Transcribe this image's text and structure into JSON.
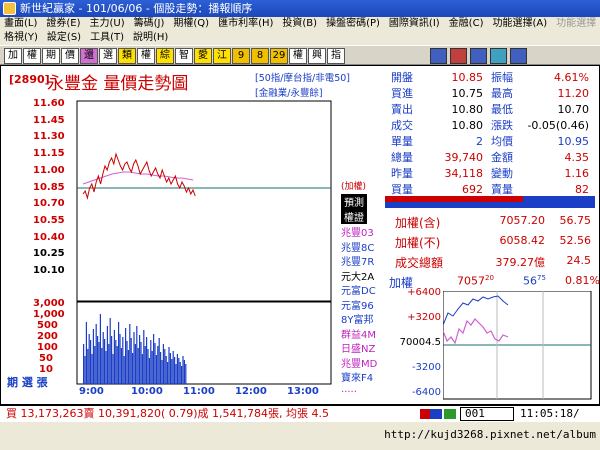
{
  "window": {
    "title": "新世紀贏家 - 101/06/06 - 個股走勢：播報順序"
  },
  "menu": {
    "row1": [
      "畫面(L)",
      "證券(E)",
      "主力(U)",
      "籌碼(J)",
      "期權(Q)",
      "匯市利率(H)",
      "投資(B)",
      "操盤密碼(P)",
      "國際資訊(I)",
      "金融(C)",
      "功能選擇(A)",
      "功能選擇"
    ],
    "row2": [
      "格視(Y)",
      "設定(S)",
      "工具(T)",
      "說明(H)"
    ]
  },
  "toolbar": {
    "buttons": [
      "加",
      "權",
      "期",
      "價",
      "還",
      "選",
      "類",
      "權",
      "綜",
      "智",
      "愛",
      "江",
      "9",
      "8",
      "29",
      "權",
      "興",
      "指"
    ]
  },
  "stock": {
    "code": "[2890]",
    "name": "永豐金",
    "chart_title": "量價走勢圖",
    "index_label_1": "[50指/摩台指/非電50]",
    "index_label_2": "[金融業/永豐餘]"
  },
  "price_axis": [
    "11.60",
    "11.45",
    "11.30",
    "11.15",
    "11.00",
    "10.85",
    "10.70",
    "10.55",
    "10.40",
    "10.25",
    "10.10"
  ],
  "volume_axis": [
    "3,000",
    "1,000",
    "500",
    "200",
    "100",
    "50",
    "10"
  ],
  "time_axis": [
    "9:00",
    "10:00",
    "11:00",
    "12:00",
    "13:00"
  ],
  "volume_side_label": "期 選 張",
  "side_list": {
    "header1": "(加權)",
    "header2": "預測",
    "header3": "權證",
    "items": [
      "兆豐03",
      "兆豐8C",
      "兆豐7R",
      "元大2A",
      "元富DC",
      "元富96",
      "8Y富邦",
      "群益4M",
      "日盛NZ",
      "兆豐MD",
      "寶來F4",
      "....."
    ]
  },
  "quote": {
    "rows": [
      [
        "開盤",
        "10.85",
        "振幅",
        "4.61%"
      ],
      [
        "買進",
        "10.75",
        "最高",
        "11.20"
      ],
      [
        "賣出",
        "10.80",
        "最低",
        "10.70"
      ],
      [
        "成交",
        "10.80",
        "漲跌",
        "-0.05(0.46)"
      ],
      [
        "單量",
        "2",
        "均價",
        "10.95"
      ],
      [
        "總量",
        "39,740",
        "金額",
        "4.35"
      ],
      [
        "昨量",
        "34,118",
        "變動",
        "1.16"
      ],
      [
        "買量",
        "692",
        "賣量",
        "82"
      ]
    ]
  },
  "index_panel": {
    "rows": [
      [
        "加權(含)",
        "7057.20",
        "56.75"
      ],
      [
        "加權(不)",
        "6058.42",
        "52.56"
      ],
      [
        "成交總額",
        "379.27億",
        "24.5"
      ]
    ]
  },
  "mini_chart": {
    "label": "加權",
    "value": "7057",
    "value_decimal": "20",
    "change": "56",
    "change_decimal": "75",
    "pct": "0.81%",
    "y_axis": [
      "+6400",
      "+3200",
      "70004.5",
      "-3200",
      "-6400"
    ]
  },
  "status": {
    "text": "買 13,173,263賣 10,391,820( 0.79)成 1,541,784張, 均張 4.5",
    "code_input": "001",
    "time": "11:05:18/"
  },
  "footer": {
    "url": "http://kujd3268.pixnet.net/album"
  },
  "colors": {
    "up": "#cc0000",
    "down": "#1a3ec6",
    "bg": "#ffffff"
  }
}
